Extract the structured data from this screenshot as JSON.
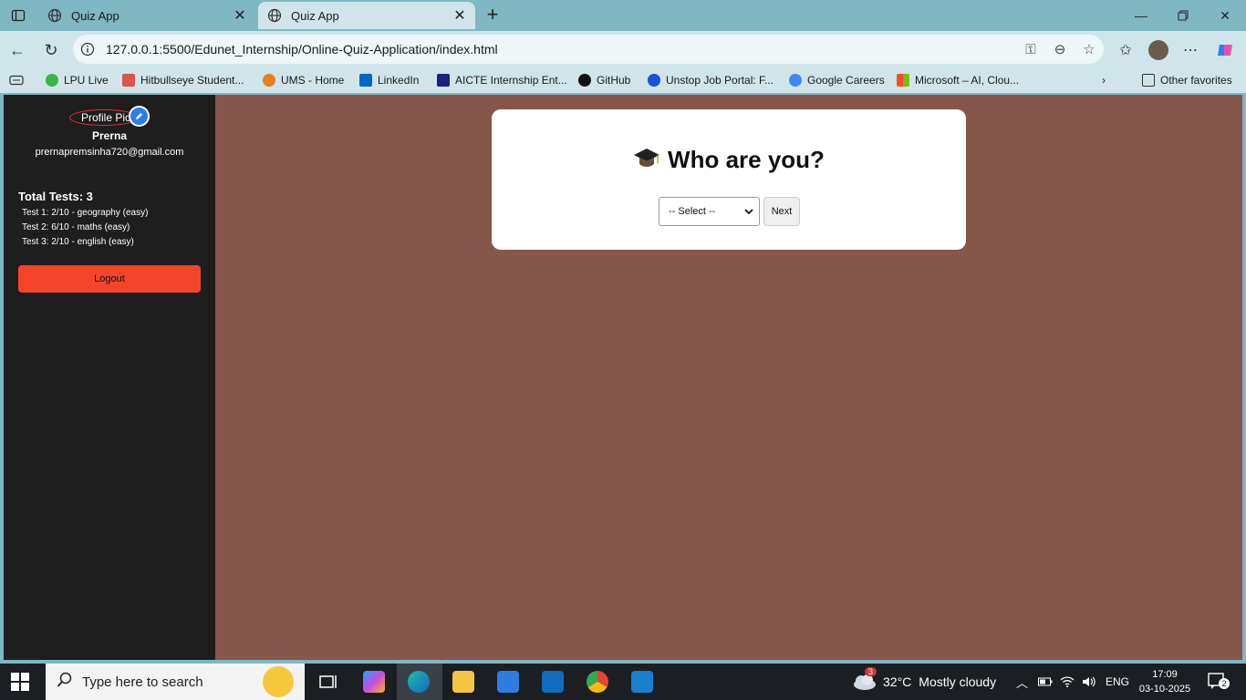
{
  "browser": {
    "tabs": [
      {
        "title": "Quiz App"
      },
      {
        "title": "Quiz App"
      }
    ],
    "url": "127.0.0.1:5500/Edunet_Internship/Online-Quiz-Application/index.html",
    "bookmarks": [
      {
        "label": "LPU Live",
        "icon_color": "#3bb54a"
      },
      {
        "label": "Hitbullseye Student...",
        "icon_color": "#d9534f"
      },
      {
        "label": "UMS - Home",
        "icon_color": "#e67e22"
      },
      {
        "label": "LinkedIn",
        "icon_color": "#0a66c2"
      },
      {
        "label": "AICTE Internship Ent...",
        "icon_color": "#1a237e"
      },
      {
        "label": "GitHub",
        "icon_color": "#111111"
      },
      {
        "label": "Unstop Job Portal: F...",
        "icon_color": "#1c4ed8"
      },
      {
        "label": "Google Careers",
        "icon_color": "#4285f4"
      },
      {
        "label": "Microsoft – AI, Clou...",
        "icon_color": "#f25022"
      }
    ],
    "other_favorites": "Other favorites"
  },
  "sidebar": {
    "profile_alt": "Profile Pic",
    "name": "Prerna",
    "email": "prernapremsinha720@gmail.com",
    "total_tests": "Total Tests: 3",
    "tests": [
      "Test 1: 2/10 - geography (easy)",
      "Test 2: 6/10 - maths (easy)",
      "Test 3: 2/10 - english (easy)"
    ],
    "logout": "Logout"
  },
  "main": {
    "heading": "Who are you?",
    "select_value": "-- Select --",
    "next": "Next"
  },
  "taskbar": {
    "search_placeholder": "Type here to search",
    "weather_temp": "32°C",
    "weather_text": "Mostly cloudy",
    "weather_badge": "3",
    "lang": "ENG",
    "time": "17:09",
    "date": "03-10-2025",
    "notif_count": "2"
  },
  "colors": {
    "page_bg": "#87564b",
    "sidebar_bg": "#1e1e1e",
    "logout_bg": "#f4452a",
    "browser_chrome": "#7fb7c2"
  }
}
